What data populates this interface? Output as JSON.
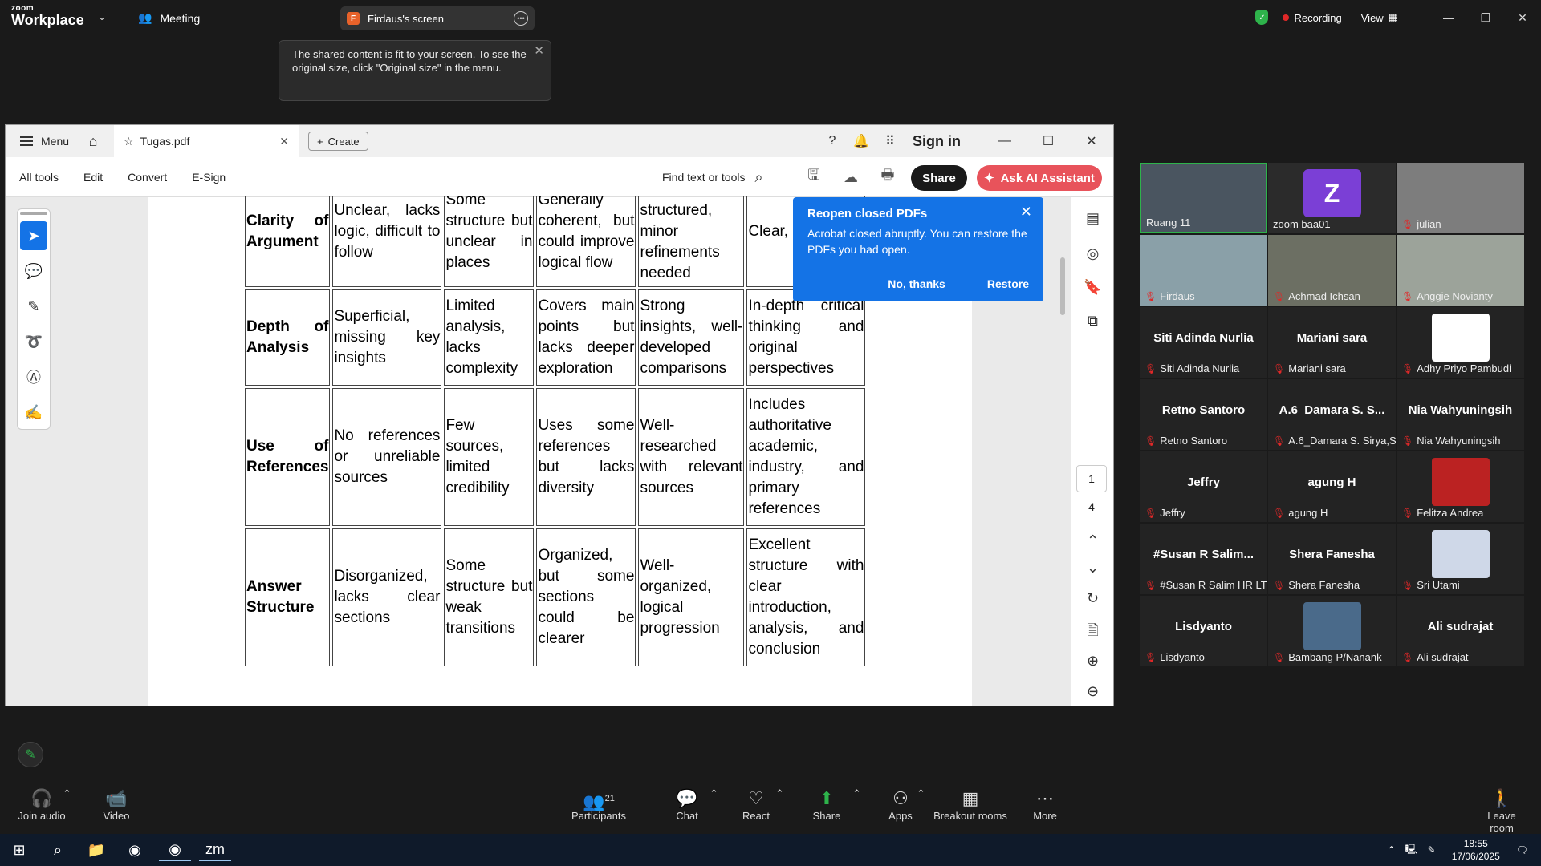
{
  "zoom": {
    "logo_line1": "zoom",
    "logo_line2": "Workplace",
    "meeting_label": "Meeting",
    "share_tab": {
      "badge": "F",
      "label": "Firdaus's screen"
    },
    "recording_label": "Recording",
    "view_label": "View",
    "toast_text": "The shared content is fit to your screen. To see the original size, click \"Original size\" in the menu."
  },
  "acrobat": {
    "menu_label": "Menu",
    "tab_title": "Tugas.pdf",
    "create_label": "Create",
    "sign_in_label": "Sign in",
    "toolbar": {
      "all_tools": "All tools",
      "edit": "Edit",
      "convert": "Convert",
      "esign": "E-Sign"
    },
    "find_label": "Find text or tools",
    "share_label": "Share",
    "ai_label": "Ask AI Assistant",
    "page_current": "1",
    "page_total": "4",
    "popup": {
      "title": "Reopen closed PDFs",
      "body": "Acrobat closed abruptly. You can restore the PDFs you had open.",
      "no_label": "No, thanks",
      "restore_label": "Restore"
    }
  },
  "rubric": {
    "rows": [
      {
        "criterion": "Clarity of Argument",
        "cells": [
          "Unclear, lacks logic, difficult to follow",
          "Some structure but unclear in places",
          "Generally coherent, but could improve logical flow",
          "Well-structured, minor refinements needed",
          "Clear, easy to"
        ]
      },
      {
        "criterion": "Depth of Analysis",
        "cells": [
          "Superficial, missing key insights",
          "Limited analysis, lacks complexity",
          "Covers main points but lacks deeper exploration",
          "Strong insights, well-developed comparisons",
          "In-depth critical thinking and original perspectives"
        ]
      },
      {
        "criterion": "Use of References",
        "cells": [
          "No references or unreliable sources",
          "Few sources, limited credibility",
          "Uses some references but lacks diversity",
          "Well-researched with relevant sources",
          "Includes authoritative academic, industry, and primary references"
        ]
      },
      {
        "criterion": "Answer Structure",
        "cells": [
          "Disorganized, lacks clear sections",
          "Some structure but weak transitions",
          "Organized, but some sections could be clearer",
          "Well-organized, logical progression",
          "Excellent structure with clear introduction, analysis, and conclusion"
        ]
      }
    ]
  },
  "participants": [
    {
      "name": "Ruang 11",
      "kind": "video",
      "highlight": true
    },
    {
      "name": "zoom baa01",
      "kind": "initial",
      "initial": "Z"
    },
    {
      "name": "julian",
      "kind": "video"
    },
    {
      "name": "Firdaus",
      "kind": "video"
    },
    {
      "name": "Achmad Ichsan",
      "kind": "video"
    },
    {
      "name": "Anggie Novianty",
      "kind": "video"
    },
    {
      "name": "Siti Adinda Nurlia",
      "big": "Siti Adinda Nurlia"
    },
    {
      "name": "Mariani sara",
      "big": "Mariani sara"
    },
    {
      "name": "Adhy Priyo Pambudi",
      "kind": "logo"
    },
    {
      "name": "Retno Santoro",
      "big": "Retno Santoro"
    },
    {
      "name": "A.6_Damara S. Sirya,S...",
      "big": "A.6_Damara S. S..."
    },
    {
      "name": "Nia Wahyuningsih",
      "big": "Nia Wahyuningsih"
    },
    {
      "name": "Jeffry",
      "big": "Jeffry"
    },
    {
      "name": "agung H",
      "big": "agung H"
    },
    {
      "name": "Felitza Andrea",
      "kind": "photo"
    },
    {
      "name": "#Susan R Salim HR LTD",
      "big": "#Susan R Salim..."
    },
    {
      "name": "Shera Fanesha",
      "big": "Shera Fanesha"
    },
    {
      "name": "Sri Utami",
      "kind": "photo"
    },
    {
      "name": "Lisdyanto",
      "big": "Lisdyanto"
    },
    {
      "name": "Bambang P/Nanank",
      "kind": "photo"
    },
    {
      "name": "Ali sudrajat",
      "big": "Ali sudrajat"
    }
  ],
  "bottombar": {
    "join_audio": "Join audio",
    "video": "Video",
    "participants": "Participants",
    "participants_count": "21",
    "chat": "Chat",
    "react": "React",
    "share": "Share",
    "apps": "Apps",
    "breakout": "Breakout rooms",
    "more": "More",
    "leave": "Leave room"
  },
  "taskbar": {
    "time": "18:55",
    "date": "17/06/2025"
  },
  "colors": {
    "zoom_bg": "#1a1a1a",
    "acrobat_blue": "#1473e6",
    "ai_button": "#e8535b",
    "share_green": "#2eb34b",
    "mute_red": "#e02828"
  }
}
